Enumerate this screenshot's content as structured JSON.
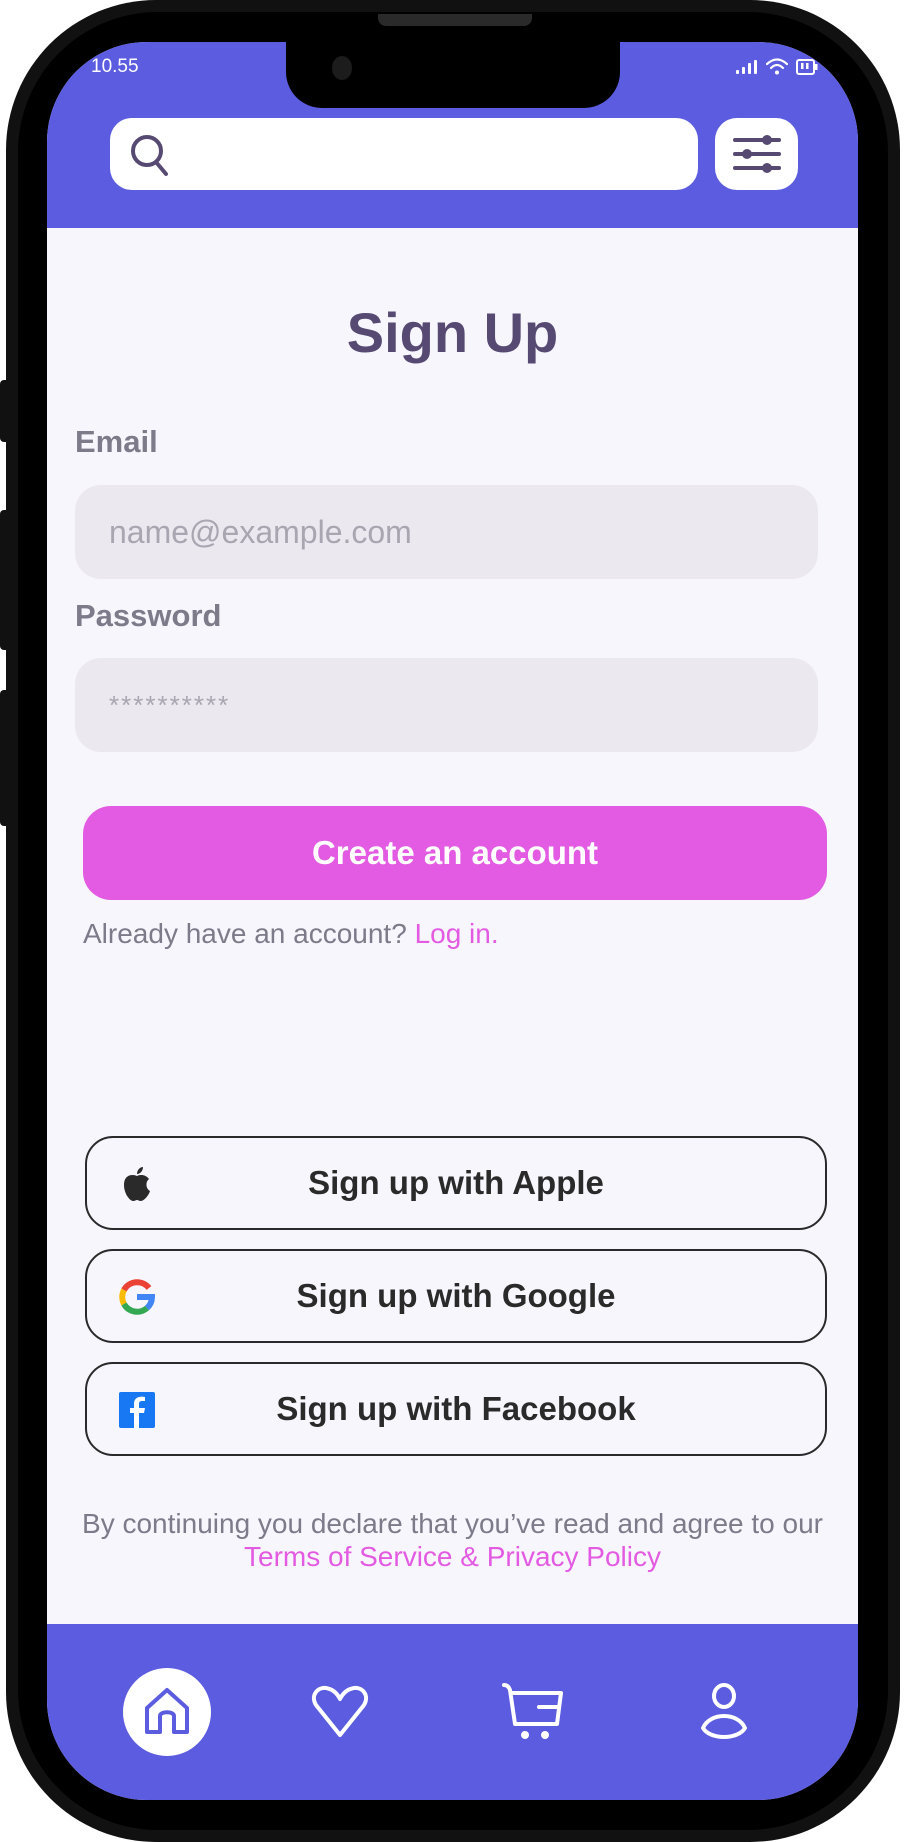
{
  "status_bar": {
    "time": "10.55",
    "icons": [
      "signal-icon",
      "wifi-icon",
      "battery-icon"
    ]
  },
  "header": {
    "search": {
      "placeholder": "",
      "value": "",
      "icon": "search-icon"
    },
    "filter_button": {
      "icon": "sliders-icon"
    }
  },
  "main": {
    "title": "Sign Up",
    "email": {
      "label": "Email",
      "placeholder": "name@example.com",
      "value": ""
    },
    "password": {
      "label": "Password",
      "placeholder": "**********",
      "value": ""
    },
    "create_button": "Create an account",
    "login_prompt": {
      "text": "Already have an account?",
      "link": "Log in."
    },
    "social": [
      {
        "label": "Sign up with Apple",
        "icon": "apple-icon"
      },
      {
        "label": "Sign up with Google",
        "icon": "google-icon"
      },
      {
        "label": "Sign up with Facebook",
        "icon": "facebook-icon"
      }
    ],
    "terms": {
      "text": "By continuing you declare that you’ve read and agree to our",
      "link": "Terms of Service & Privacy Policy"
    }
  },
  "bottom_nav": {
    "items": [
      {
        "name": "home",
        "icon": "home-icon",
        "active": true
      },
      {
        "name": "favorites",
        "icon": "heart-icon",
        "active": false
      },
      {
        "name": "cart",
        "icon": "cart-icon",
        "active": false
      },
      {
        "name": "profile",
        "icon": "user-icon",
        "active": false
      }
    ]
  },
  "colors": {
    "primary": "#5c5ce0",
    "accent": "#e25be2",
    "title": "#574a72",
    "muted_text": "#7d7a8a",
    "field_bg": "#ebe8ef",
    "background": "#f8f6fd"
  }
}
